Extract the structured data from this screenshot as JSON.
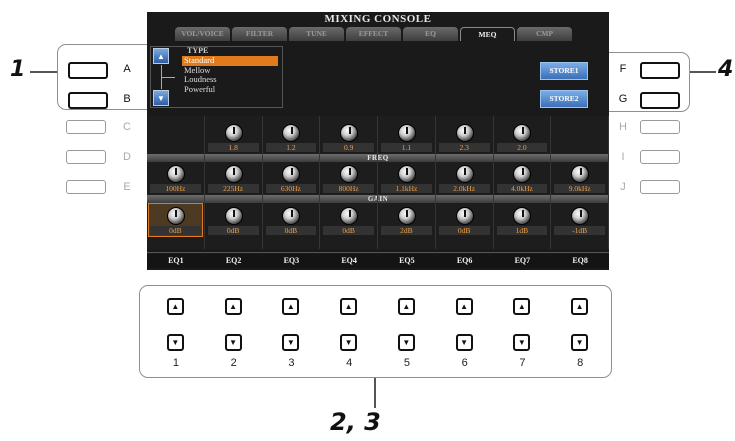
{
  "screen": {
    "title": "MIXING CONSOLE",
    "tabs": [
      {
        "label": "VOL/VOICE",
        "active": false
      },
      {
        "label": "FILTER",
        "active": false
      },
      {
        "label": "TUNE",
        "active": false
      },
      {
        "label": "EFFECT",
        "active": false
      },
      {
        "label": "EQ",
        "active": false
      },
      {
        "label": "MEQ",
        "active": true
      },
      {
        "label": "CMP",
        "active": false
      }
    ],
    "type_panel": {
      "label": "TYPE",
      "options": [
        "Standard",
        "Mellow",
        "Loudness",
        "Powerful"
      ],
      "selected": "Standard",
      "up_icon": "triangle-up-icon",
      "down_icon": "triangle-down-icon"
    },
    "store_buttons": [
      "STORE1",
      "STORE2"
    ],
    "q_values": [
      "",
      "1.8",
      "1.2",
      "0.9",
      "1.1",
      "2.3",
      "2.0",
      ""
    ],
    "freq_label": "FREQ",
    "freq_values": [
      "100Hz",
      "225Hz",
      "630Hz",
      "800Hz",
      "1.1kHz",
      "2.0kHz",
      "4.0kHz",
      "9.0kHz"
    ],
    "gain_label": "GAIN",
    "gain_values": [
      "0dB",
      "0dB",
      "0dB",
      "0dB",
      "2dB",
      "0dB",
      "1dB",
      "-1dB"
    ],
    "eq_labels": [
      "EQ1",
      "EQ2",
      "EQ3",
      "EQ4",
      "EQ5",
      "EQ6",
      "EQ7",
      "EQ8"
    ],
    "selected_eq": "EQ1"
  },
  "panel": {
    "left_buttons": [
      "A",
      "B",
      "C",
      "D",
      "E"
    ],
    "right_buttons": [
      "F",
      "G",
      "H",
      "I",
      "J"
    ],
    "bottom_numbers": [
      "1",
      "2",
      "3",
      "4",
      "5",
      "6",
      "7",
      "8"
    ],
    "up_icon": "up-arrow-icon",
    "down_icon": "down-arrow-icon"
  },
  "callouts": {
    "left": "1",
    "right": "4",
    "bottom": "2, 3"
  }
}
